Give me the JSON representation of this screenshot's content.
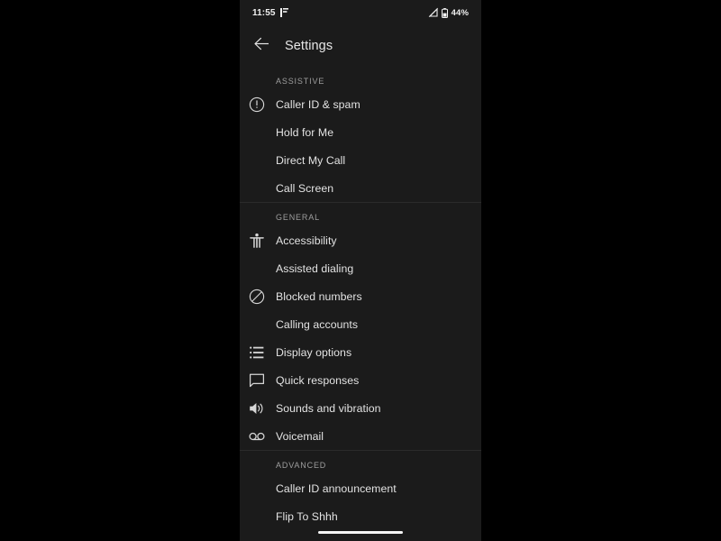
{
  "statusbar": {
    "time": "11:55",
    "left_icon": "vibrate-icon",
    "signal_icon": "signal-no-service-icon",
    "battery_icon": "battery-icon",
    "battery_text": "44%"
  },
  "appbar": {
    "back_icon": "back-arrow-icon",
    "title": "Settings"
  },
  "theme": {
    "background": "#000000",
    "panel": "#1b1b1b",
    "divider": "#2b2b2b",
    "primary_text": "#e3e3e3",
    "secondary_text": "#9e9e9e",
    "icon": "#d6d6d6"
  },
  "sections": [
    {
      "header": "ASSISTIVE",
      "items": [
        {
          "label": "Caller ID & spam",
          "icon": "error-circle-icon"
        },
        {
          "label": "Hold for Me",
          "icon": null
        },
        {
          "label": "Direct My Call",
          "icon": null
        },
        {
          "label": "Call Screen",
          "icon": null
        }
      ]
    },
    {
      "header": "GENERAL",
      "items": [
        {
          "label": "Accessibility",
          "icon": "accessibility-icon"
        },
        {
          "label": "Assisted dialing",
          "icon": null
        },
        {
          "label": "Blocked numbers",
          "icon": "block-icon"
        },
        {
          "label": "Calling accounts",
          "icon": null
        },
        {
          "label": "Display options",
          "icon": "list-icon"
        },
        {
          "label": "Quick responses",
          "icon": "chat-bubble-icon"
        },
        {
          "label": "Sounds and vibration",
          "icon": "volume-up-icon"
        },
        {
          "label": "Voicemail",
          "icon": "voicemail-icon"
        }
      ]
    },
    {
      "header": "ADVANCED",
      "items": [
        {
          "label": "Caller ID announcement",
          "icon": null
        },
        {
          "label": "Flip To Shhh",
          "icon": null
        }
      ]
    }
  ],
  "navbar": {
    "handle": "gesture-home-handle"
  }
}
